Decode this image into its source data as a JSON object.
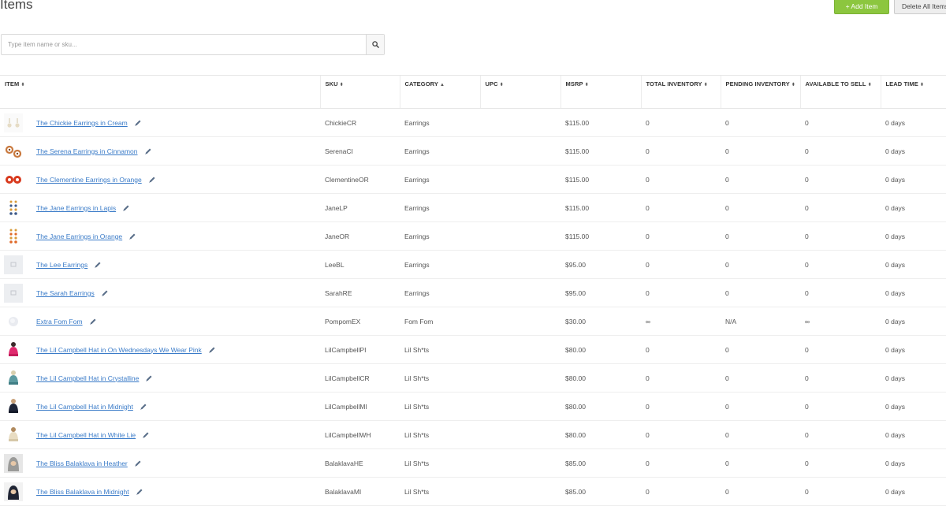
{
  "page": {
    "title": "Items",
    "add_button": "+ Add Item",
    "delete_button": "Delete All Items"
  },
  "search": {
    "placeholder": "Type item name or sku...",
    "value": "",
    "icon": "search-icon"
  },
  "table": {
    "columns": [
      {
        "label": "ITEM",
        "sort": "⬍"
      },
      {
        "label": "SKU",
        "sort": "⬍"
      },
      {
        "label": "CATEGORY",
        "sort": "▲"
      },
      {
        "label": "UPC",
        "sort": "⬍"
      },
      {
        "label": "MSRP",
        "sort": "⬍"
      },
      {
        "label": "TOTAL INVENTORY",
        "sort": "⬍"
      },
      {
        "label": "PENDING INVENTORY",
        "sort": "⬍"
      },
      {
        "label": "AVAILABLE TO SELL",
        "sort": "⬍"
      },
      {
        "label": "LEAD TIME",
        "sort": "⬍"
      }
    ],
    "rows": [
      {
        "name": "The Chickie Earrings in Cream",
        "sku": "ChickieCR",
        "category": "Earrings",
        "upc": "",
        "msrp": "$115.00",
        "total": "0",
        "pending": "0",
        "available": "0",
        "lead": "0 days",
        "thumb": "cream-earrings"
      },
      {
        "name": "The Serena Earrings in Cinnamon",
        "sku": "SerenaCI",
        "category": "Earrings",
        "upc": "",
        "msrp": "$115.00",
        "total": "0",
        "pending": "0",
        "available": "0",
        "lead": "0 days",
        "thumb": "cinnamon-earrings"
      },
      {
        "name": "The Clementine Earrings in Orange",
        "sku": "ClementineOR",
        "category": "Earrings",
        "upc": "",
        "msrp": "$115.00",
        "total": "0",
        "pending": "0",
        "available": "0",
        "lead": "0 days",
        "thumb": "orange-earrings"
      },
      {
        "name": "The Jane Earrings in Lapis",
        "sku": "JaneLP",
        "category": "Earrings",
        "upc": "",
        "msrp": "$115.00",
        "total": "0",
        "pending": "0",
        "available": "0",
        "lead": "0 days",
        "thumb": "lapis-drop-earrings"
      },
      {
        "name": "The Jane Earrings in Orange",
        "sku": "JaneOR",
        "category": "Earrings",
        "upc": "",
        "msrp": "$115.00",
        "total": "0",
        "pending": "0",
        "available": "0",
        "lead": "0 days",
        "thumb": "orange-drop-earrings"
      },
      {
        "name": "The Lee Earrings",
        "sku": "LeeBL",
        "category": "Earrings",
        "upc": "",
        "msrp": "$95.00",
        "total": "0",
        "pending": "0",
        "available": "0",
        "lead": "0 days",
        "thumb": "placeholder"
      },
      {
        "name": "The Sarah Earrings",
        "sku": "SarahRE",
        "category": "Earrings",
        "upc": "",
        "msrp": "$95.00",
        "total": "0",
        "pending": "0",
        "available": "0",
        "lead": "0 days",
        "thumb": "placeholder"
      },
      {
        "name": "Extra Fom Fom",
        "sku": "PompomEX",
        "category": "Fom Fom",
        "upc": "",
        "msrp": "$30.00",
        "total": "∞",
        "pending": "N/A",
        "available": "∞",
        "lead": "0 days",
        "thumb": "pompom"
      },
      {
        "name": "The Lil Campbell Hat in On Wednesdays We Wear Pink",
        "sku": "LilCampbellPI",
        "category": "Lil Sh*ts",
        "upc": "",
        "msrp": "$80.00",
        "total": "0",
        "pending": "0",
        "available": "0",
        "lead": "0 days",
        "thumb": "hat-pink"
      },
      {
        "name": "The Lil Campbell Hat in Crystalline",
        "sku": "LilCampbellCR",
        "category": "Lil Sh*ts",
        "upc": "",
        "msrp": "$80.00",
        "total": "0",
        "pending": "0",
        "available": "0",
        "lead": "0 days",
        "thumb": "hat-crystalline"
      },
      {
        "name": "The Lil Campbell Hat in Midnight",
        "sku": "LilCampbellMI",
        "category": "Lil Sh*ts",
        "upc": "",
        "msrp": "$80.00",
        "total": "0",
        "pending": "0",
        "available": "0",
        "lead": "0 days",
        "thumb": "hat-midnight"
      },
      {
        "name": "The Lil Campbell Hat in White Lie",
        "sku": "LilCampbellWH",
        "category": "Lil Sh*ts",
        "upc": "",
        "msrp": "$80.00",
        "total": "0",
        "pending": "0",
        "available": "0",
        "lead": "0 days",
        "thumb": "hat-white"
      },
      {
        "name": "The Bliss Balaklava in Heather",
        "sku": "BalaklavaHE",
        "category": "Lil Sh*ts",
        "upc": "",
        "msrp": "$85.00",
        "total": "0",
        "pending": "0",
        "available": "0",
        "lead": "0 days",
        "thumb": "balaclava-heather"
      },
      {
        "name": "The Bliss Balaklava in Midnight",
        "sku": "BalaklavaMI",
        "category": "Lil Sh*ts",
        "upc": "",
        "msrp": "$85.00",
        "total": "0",
        "pending": "0",
        "available": "0",
        "lead": "0 days",
        "thumb": "balaclava-midnight"
      }
    ]
  },
  "colors": {
    "accent_green": "#8cc63f",
    "link_blue": "#3a7bc8",
    "text_gray": "#555555"
  }
}
